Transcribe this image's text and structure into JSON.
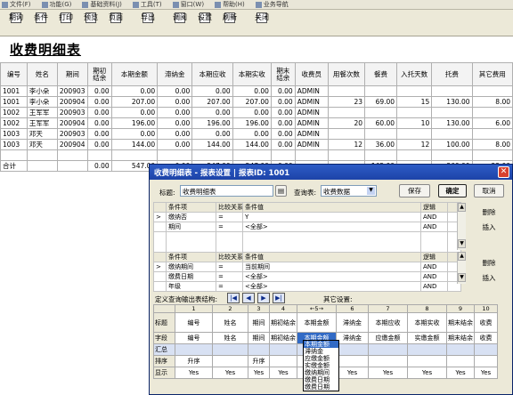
{
  "menu": [
    "文件(F)",
    "功能(G)",
    "基础资料(J)",
    "工具(T)",
    "窗口(W)",
    "帮助(H)",
    "业务导航"
  ],
  "toolbar": [
    "期询",
    "条件",
    "打印",
    "预览",
    "页面",
    "导出",
    "调阅",
    "设置",
    "刷新",
    "关闭"
  ],
  "page_title": "收费明细表",
  "grid": {
    "headers": [
      "编号",
      "姓名",
      "期间",
      "期初结余",
      "本期金额",
      "滞纳金",
      "本期应收",
      "本期实收",
      "期末结余",
      "收费员",
      "用餐次数",
      "餐费",
      "入托天数",
      "托费",
      "其它费用"
    ],
    "rows": [
      [
        "1001",
        "李小朵",
        "200903",
        "0.00",
        "0.00",
        "0.00",
        "0.00",
        "0.00",
        "0.00",
        "ADMIN",
        "",
        "",
        "",
        "",
        ""
      ],
      [
        "1001",
        "李小朵",
        "200904",
        "0.00",
        "207.00",
        "0.00",
        "207.00",
        "207.00",
        "0.00",
        "ADMIN",
        "23",
        "69.00",
        "15",
        "130.00",
        "8.00"
      ],
      [
        "1002",
        "王军军",
        "200903",
        "0.00",
        "0.00",
        "0.00",
        "0.00",
        "0.00",
        "0.00",
        "ADMIN",
        "",
        "",
        "",
        "",
        ""
      ],
      [
        "1002",
        "王军军",
        "200904",
        "0.00",
        "196.00",
        "0.00",
        "196.00",
        "196.00",
        "0.00",
        "ADMIN",
        "20",
        "60.00",
        "10",
        "130.00",
        "6.00"
      ],
      [
        "1003",
        "邓天",
        "200903",
        "0.00",
        "0.00",
        "0.00",
        "0.00",
        "0.00",
        "0.00",
        "ADMIN",
        "",
        "",
        "",
        "",
        ""
      ],
      [
        "1003",
        "邓天",
        "200904",
        "0.00",
        "144.00",
        "0.00",
        "144.00",
        "144.00",
        "0.00",
        "ADMIN",
        "12",
        "36.00",
        "12",
        "100.00",
        "8.00"
      ]
    ],
    "total": [
      "合计",
      "",
      "",
      "0.00",
      "547.00",
      "0.00",
      "547.00",
      "547.00",
      "0.00",
      "",
      "",
      "165.00",
      "",
      "360.00",
      "22.00"
    ]
  },
  "dialog": {
    "title": "收费明细表 - 报表设置 | 报表ID: 1001",
    "title_label": "标题:",
    "title_value": "收费明细表",
    "query_label": "查询表:",
    "query_value": "收费数据",
    "save": "保存",
    "ok": "确定",
    "cancel": "取消",
    "cond_headers": [
      "条件项",
      "比较关系",
      "条件值",
      "逻辑"
    ],
    "cond_rows1": [
      [
        "缴纳否",
        "=",
        "Y",
        "AND"
      ],
      [
        "期间",
        "=",
        "<全部>",
        "AND"
      ]
    ],
    "cond_rows2": [
      [
        "缴纳期间",
        "=",
        "当前期间",
        "AND"
      ],
      [
        "缴费日期",
        "=",
        "<全部>",
        "AND"
      ],
      [
        "年级",
        "=",
        "<全部>",
        "AND"
      ]
    ],
    "delete": "删除",
    "insert": "插入",
    "struct_label": "定义查询输出表结构:",
    "other_label": "其它设置:",
    "col_nums": [
      "",
      "1",
      "2",
      "3",
      "4",
      "←5→",
      "6",
      "7",
      "8",
      "9",
      "10"
    ],
    "row_labels": [
      "标题",
      "字段",
      "汇总",
      "排序",
      "显示"
    ],
    "titles": [
      "编号",
      "姓名",
      "期间",
      "期初结余",
      "本期金额",
      "滞纳金",
      "本期应收",
      "本期实收",
      "期末结余",
      "收费"
    ],
    "fields": [
      "编号",
      "姓名",
      "期间",
      "期初结余",
      "本期金额",
      "滞纳金",
      "应缴金额",
      "实缴金额",
      "期末结余",
      "收费"
    ],
    "sorts": [
      "升序",
      "",
      "升序",
      "",
      "",
      "",
      "",
      "",
      "",
      ""
    ],
    "shows": [
      "Yes",
      "Yes",
      "Yes",
      "Yes",
      "Yes",
      "Yes",
      "Yes",
      "Yes",
      "Yes",
      "Yes"
    ],
    "dropdown": [
      "本期金额",
      "滞纳金",
      "应缴金额",
      "实缴金额",
      "缴纳期间",
      "缴费日期",
      "缴费日期"
    ]
  }
}
